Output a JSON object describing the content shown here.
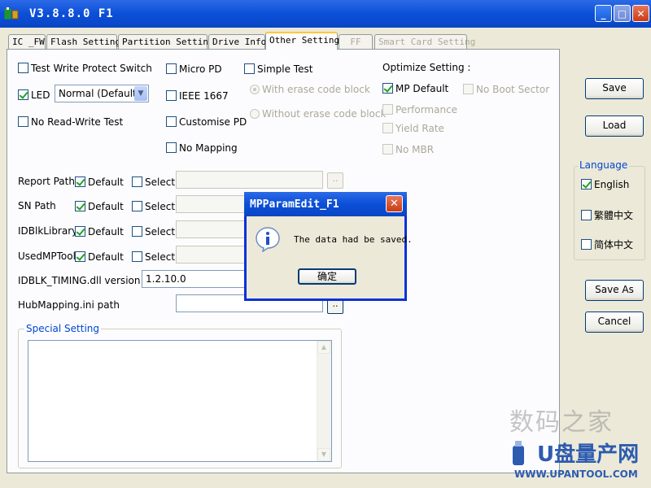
{
  "window": {
    "title": "V3.8.8.0 F1"
  },
  "tabs": [
    {
      "label": "IC _FW"
    },
    {
      "label": "Flash Setting"
    },
    {
      "label": "Partition Setting"
    },
    {
      "label": "Drive Info"
    },
    {
      "label": "Other Setting",
      "active": true
    },
    {
      "label": "FF",
      "disabled": true
    },
    {
      "label": "Smart Card Setting",
      "disabled": true
    }
  ],
  "options": {
    "test_write_protect": {
      "label": "Test Write Protect Switch",
      "checked": false
    },
    "led": {
      "label": "LED",
      "checked": true
    },
    "led_mode": {
      "value": "Normal (Default)"
    },
    "no_read_write_test": {
      "label": "No Read-Write Test",
      "checked": false
    },
    "micro_pd": {
      "label": "Micro PD",
      "checked": false
    },
    "ieee_1667": {
      "label": "IEEE 1667",
      "checked": false
    },
    "customise_pd": {
      "label": "Customise PD",
      "checked": false
    },
    "no_mapping": {
      "label": "No Mapping",
      "checked": false
    },
    "simple_test": {
      "label": "Simple Test",
      "checked": false
    },
    "with_erase": {
      "label": "With erase code block",
      "selected": true
    },
    "without_erase": {
      "label": "Without erase code block",
      "selected": false
    }
  },
  "optimize": {
    "title": "Optimize Setting :",
    "mp_default": {
      "label": "MP Default",
      "checked": true
    },
    "performance": {
      "label": "Performance"
    },
    "yield_rate": {
      "label": "Yield Rate"
    },
    "no_mbr": {
      "label": "No MBR"
    },
    "no_boot_sector": {
      "label": "No Boot Sector"
    }
  },
  "paths": {
    "report_path": {
      "label": "Report Path :"
    },
    "sn_path": {
      "label": "SN Path"
    },
    "idblk_library": {
      "label": "IDBlkLibrary:"
    },
    "used_mp_tool": {
      "label": "UsedMPTool:"
    },
    "default_label": "Default",
    "select_label": "Select",
    "browse_label": "..",
    "idblk_timing": {
      "label": "IDBLK_TIMING.dll version :",
      "value": "1.2.10.0"
    },
    "hub_mapping": {
      "label": "HubMapping.ini path"
    }
  },
  "special": {
    "title": "Special Setting"
  },
  "buttons": {
    "save": "Save",
    "load": "Load",
    "save_as": "Save As",
    "cancel": "Cancel"
  },
  "language": {
    "title": "Language",
    "english": {
      "label": "English",
      "checked": true
    },
    "traditional": {
      "label": "繁體中文",
      "checked": false
    },
    "simplified": {
      "label": "简体中文",
      "checked": false
    }
  },
  "dialog": {
    "title": "MPParamEdit_F1",
    "message": "The data had be saved.",
    "ok": "确定"
  },
  "watermark": {
    "site_cn": "数码之家",
    "brand": "U盘量产网",
    "url": "WWW.UPANTOOL.COM"
  },
  "colors": {
    "titlebar": "#0b4fd8",
    "group_title": "#0046d5",
    "check": "#21a121"
  }
}
